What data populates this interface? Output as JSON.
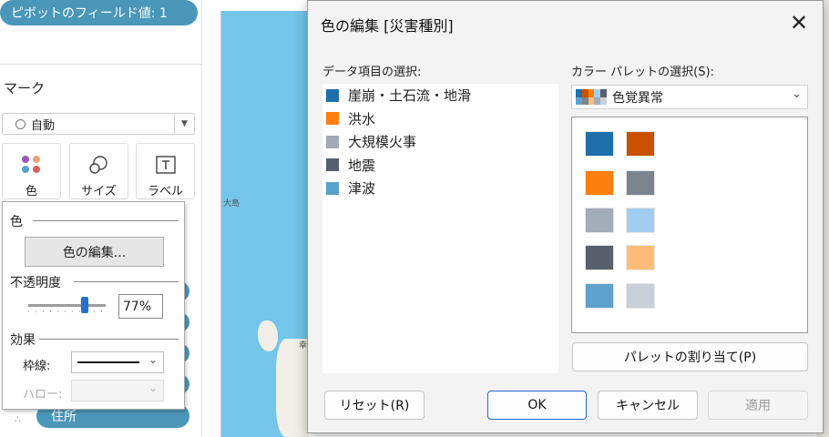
{
  "pill_top": "ピボットのフィールド値: 1",
  "marks": {
    "title": "マーク",
    "type_value": "自動",
    "buttons": [
      {
        "label": "色",
        "icon": "color-dots-icon"
      },
      {
        "label": "サイズ",
        "icon": "size-circles-icon"
      },
      {
        "label": "ラベル",
        "icon": "label-t-icon"
      }
    ],
    "address_pill": "住所",
    "tiny_icon": "∴"
  },
  "color_popover": {
    "color_section": "色",
    "edit_colors_button": "色の編集...",
    "opacity_section": "不透明度",
    "opacity_value": "77%",
    "opacity_fraction": 0.77,
    "effects_section": "効果",
    "border_label": "枠線:",
    "halo_label": "ハロー:"
  },
  "map": {
    "label_island": "大島",
    "label_city": "幸"
  },
  "dialog": {
    "title": "色の編集 [災害種別]",
    "data_items_label": "データ項目の選択:",
    "items": [
      {
        "label": "崖崩・土石流・地滑",
        "color": "#1f6fab"
      },
      {
        "label": "洪水",
        "color": "#ff7f0e"
      },
      {
        "label": "大規模火事",
        "color": "#a2aab6"
      },
      {
        "label": "地震",
        "color": "#56606e"
      },
      {
        "label": "津波",
        "color": "#5aa0cc"
      }
    ],
    "palette_label": "カラー パレットの選択(S):",
    "palette_value": "色覚異常",
    "palette_colors": [
      [
        "#1f6fab",
        "#c85200"
      ],
      [
        "#fd7f0e",
        "#7b848f"
      ],
      [
        "#a3acb9",
        "#a3cdf0"
      ],
      [
        "#57606c",
        "#ffbc79"
      ],
      [
        "#5fa2ce",
        "#c8d0d9"
      ]
    ],
    "assign_button": "パレットの割り当て(P)",
    "reset_button": "リセット(R)",
    "ok_button": "OK",
    "cancel_button": "キャンセル",
    "apply_button": "適用"
  }
}
